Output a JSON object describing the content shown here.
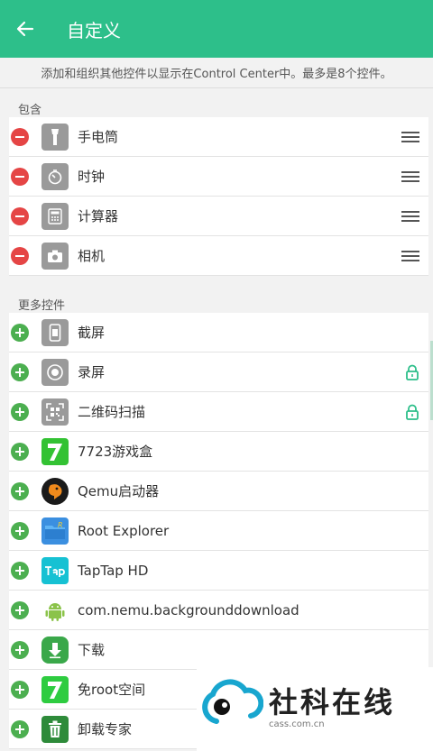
{
  "header": {
    "title": "自定义"
  },
  "description": "添加和组织其他控件以显示在Control Center中。最多是8个控件。",
  "included": {
    "label": "包含",
    "items": [
      {
        "label": "手电筒",
        "icon": "flashlight-icon"
      },
      {
        "label": "时钟",
        "icon": "timer-icon"
      },
      {
        "label": "计算器",
        "icon": "calculator-icon"
      },
      {
        "label": "相机",
        "icon": "camera-icon"
      }
    ]
  },
  "more": {
    "label": "更多控件",
    "items": [
      {
        "label": "截屏",
        "icon": "screenshot-icon",
        "locked": false
      },
      {
        "label": "录屏",
        "icon": "screen-record-icon",
        "locked": true
      },
      {
        "label": "二维码扫描",
        "icon": "qr-scan-icon",
        "locked": true
      },
      {
        "label": "7723游戏盒",
        "icon": "app-7723-icon",
        "locked": false
      },
      {
        "label": "Qemu启动器",
        "icon": "qemu-icon",
        "locked": false
      },
      {
        "label": "Root Explorer",
        "icon": "root-explorer-icon",
        "locked": false
      },
      {
        "label": "TapTap HD",
        "icon": "taptap-icon",
        "locked": false
      },
      {
        "label": "com.nemu.backgrounddownload",
        "icon": "android-icon",
        "locked": false
      },
      {
        "label": "下载",
        "icon": "download-icon",
        "locked": false
      },
      {
        "label": "免root空间",
        "icon": "noroot-space-icon",
        "locked": false
      },
      {
        "label": "卸载专家",
        "icon": "uninstall-icon",
        "locked": false
      }
    ]
  },
  "watermark": {
    "text": "社科在线",
    "sub": "cass.com.cn"
  },
  "colors": {
    "accent": "#2dbf8a",
    "remove": "#e54545",
    "add": "#4caf50"
  }
}
